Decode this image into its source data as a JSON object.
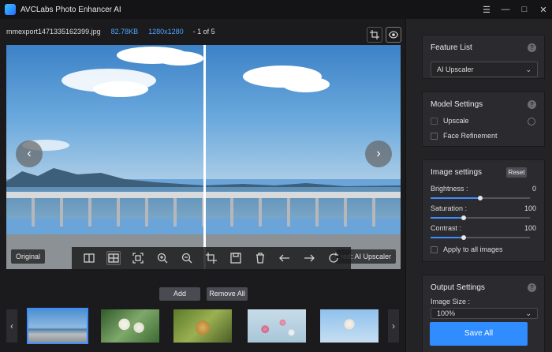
{
  "app": {
    "title": "AVCLabs Photo Enhancer AI"
  },
  "window_controls": {
    "menu": "☰",
    "minimize": "—",
    "maximize": "□",
    "close": "✕"
  },
  "file_info": {
    "name": "mmexport1471335162399.jpg",
    "size": "82.78KB",
    "resolution": "1280x1280",
    "count": "- 1 of 5"
  },
  "viewer": {
    "label_left": "Original",
    "label_right": "red: AI Upscaler",
    "prev": "‹",
    "next": "›"
  },
  "toolbar": {
    "tools": [
      "split-view-icon",
      "compare-view-icon",
      "fit-screen-icon",
      "zoom-in-icon",
      "zoom-out-icon",
      "crop-icon",
      "save-icon",
      "delete-icon",
      "arrow-left-icon",
      "arrow-right-icon",
      "rotate-icon"
    ]
  },
  "bottom": {
    "add_label": "Add",
    "remove_all_label": "Remove All",
    "prev": "‹",
    "next": "›"
  },
  "panel": {
    "feature_list": {
      "title": "Feature List",
      "help": "?",
      "selected": "AI Upscaler"
    },
    "model_settings": {
      "title": "Model Settings",
      "help": "?",
      "upscale": "Upscale",
      "face_refinement": "Face Refinement"
    },
    "image_settings": {
      "title": "Image settings",
      "reset": "Reset",
      "brightness": {
        "label": "Brightness :",
        "value": "0"
      },
      "saturation": {
        "label": "Saturation :",
        "value": "100"
      },
      "contrast": {
        "label": "Contrast :",
        "value": "100"
      },
      "apply_all": "Apply to all images"
    },
    "output_settings": {
      "title": "Output Settings",
      "help": "?",
      "image_size_label": "Image Size :",
      "image_size_value": "100%"
    },
    "save_all": "Save All"
  },
  "colors": {
    "accent": "#2f8dff",
    "bg": "#1b1b1d",
    "panel": "#232326"
  }
}
